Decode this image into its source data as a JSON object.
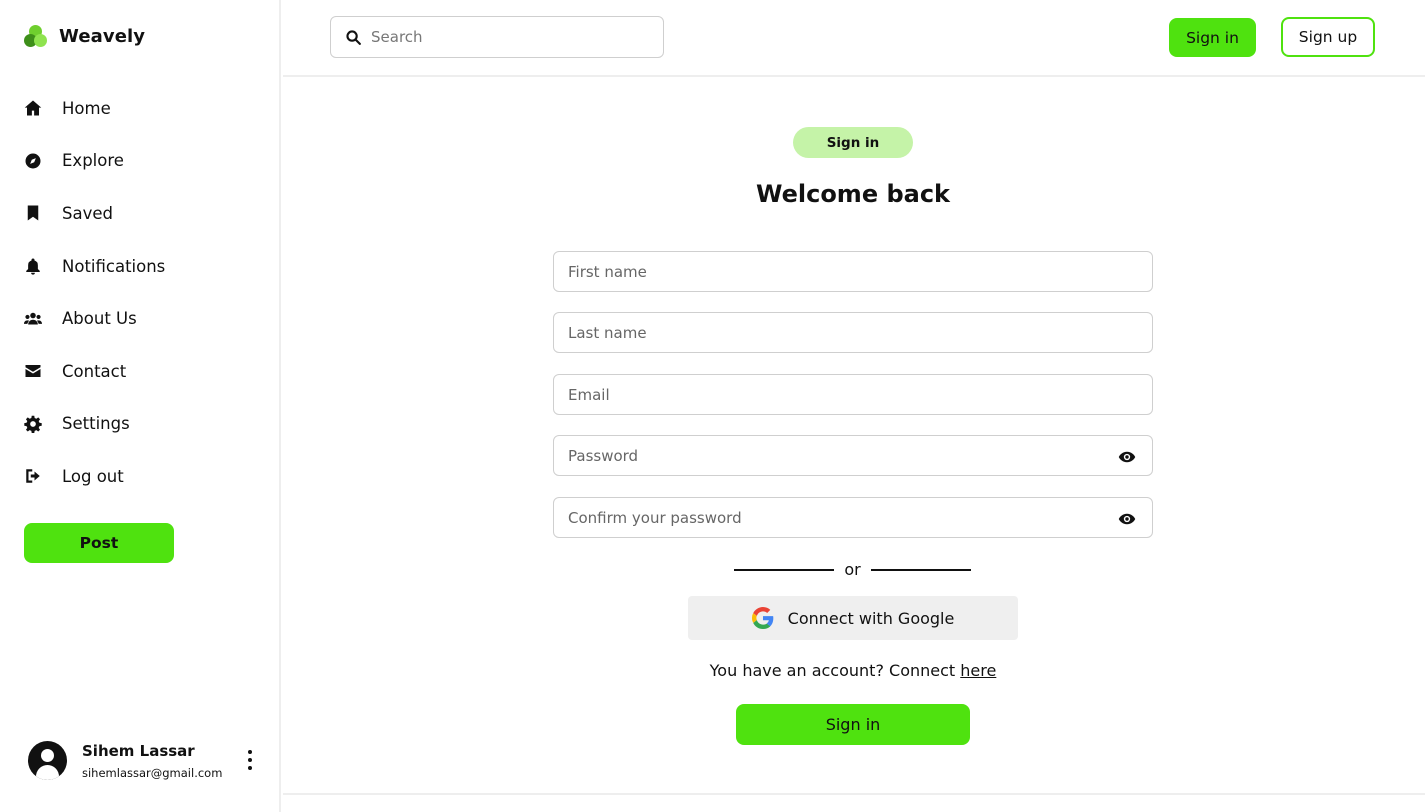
{
  "app": {
    "name": "Weavely"
  },
  "colors": {
    "accent": "#4fe20f",
    "pill_bg": "#c5f3a8",
    "google_bg": "#efefef"
  },
  "sidebar": {
    "items": [
      {
        "label": "Home",
        "icon": "home-icon"
      },
      {
        "label": "Explore",
        "icon": "compass-icon"
      },
      {
        "label": "Saved",
        "icon": "bookmark-icon"
      },
      {
        "label": "Notifications",
        "icon": "bell-icon"
      },
      {
        "label": "About Us",
        "icon": "users-icon"
      },
      {
        "label": "Contact",
        "icon": "envelope-icon"
      },
      {
        "label": "Settings",
        "icon": "gear-icon"
      },
      {
        "label": "Log out",
        "icon": "logout-icon"
      }
    ],
    "post_label": "Post",
    "profile": {
      "name": "Sihem Lassar",
      "email": "sihemlassar@gmail.com"
    }
  },
  "header": {
    "search_placeholder": "Search",
    "signin_label": "Sign in",
    "signup_label": "Sign up"
  },
  "form": {
    "pill": "Sign in",
    "title": "Welcome back",
    "first_name_placeholder": "First name",
    "last_name_placeholder": "Last name",
    "email_placeholder": "Email",
    "password_placeholder": "Password",
    "confirm_placeholder": "Confirm your password",
    "or_text": "or",
    "google_label": "Connect with Google",
    "account_text": "You have an account? Connect",
    "account_link": "here",
    "submit_label": "Sign in"
  }
}
